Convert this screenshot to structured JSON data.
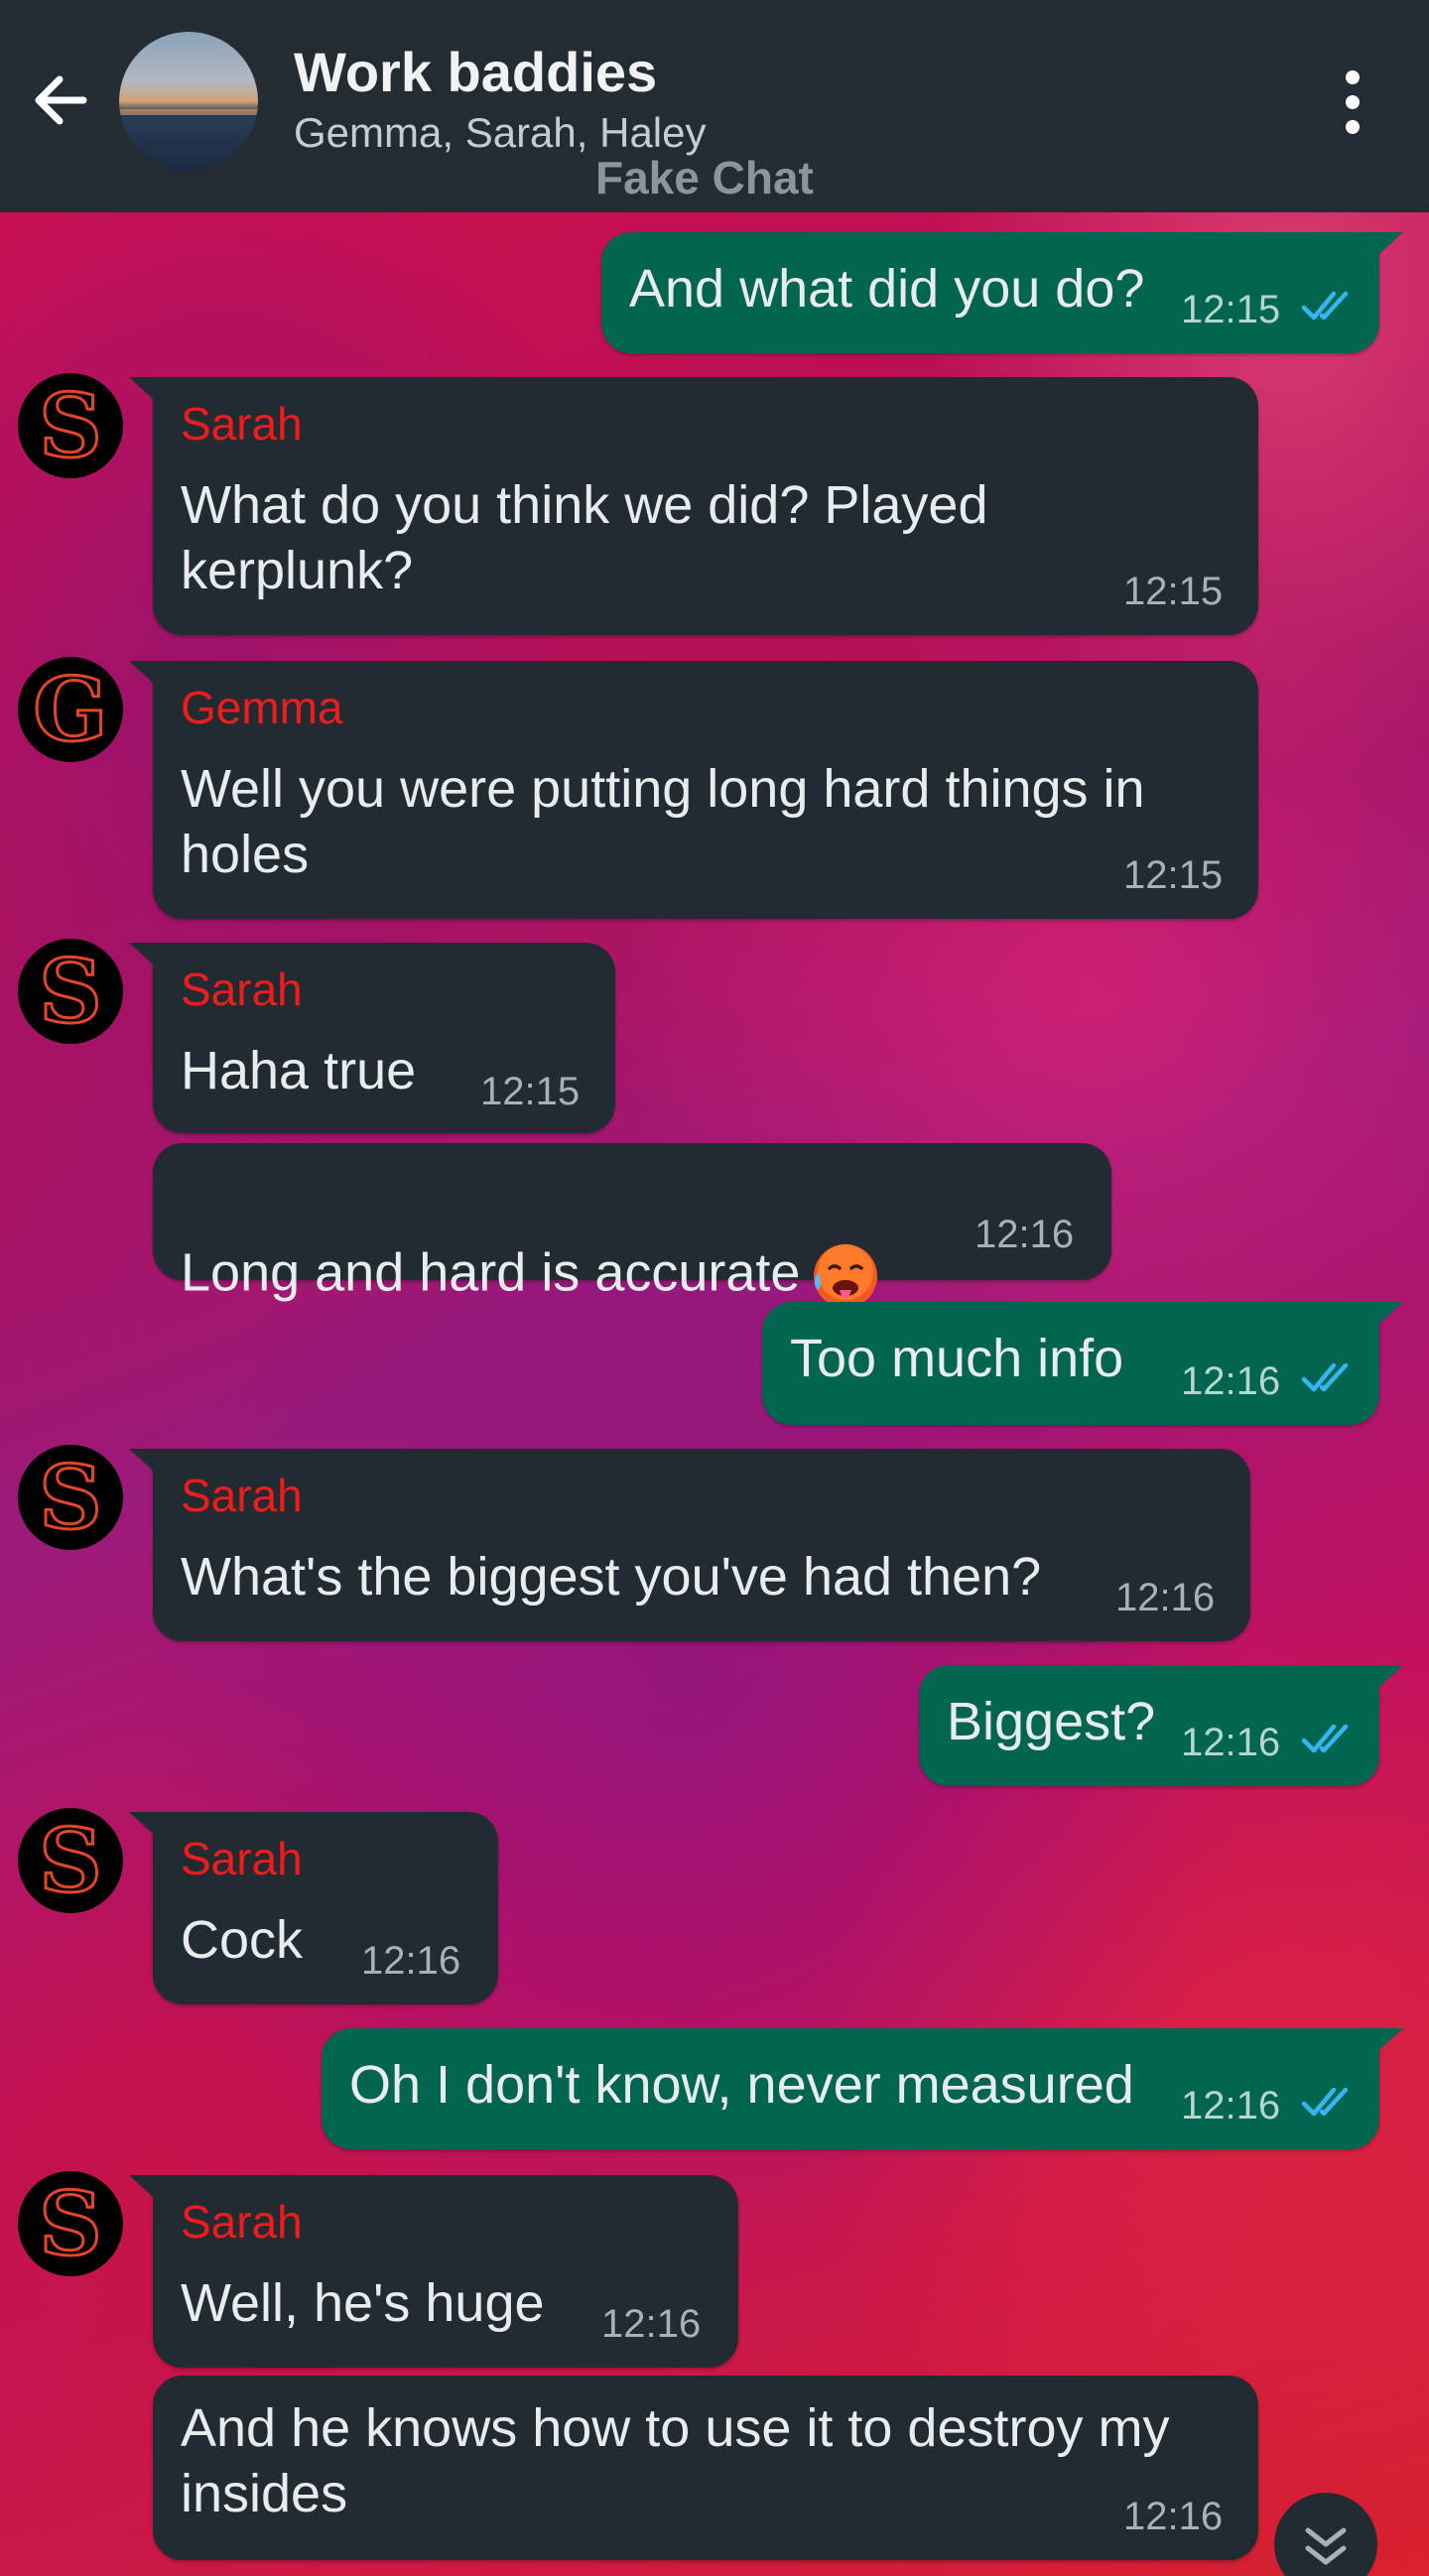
{
  "header": {
    "title": "Work baddies",
    "members": "Gemma, Sarah, Haley",
    "watermark": "Fake Chat"
  },
  "colors": {
    "header_bg": "#222c32",
    "incoming_bubble": "#222b31",
    "outgoing_bubble": "#02654f",
    "sender_name": "#ef1c1c",
    "read_ticks": "#34b7f1"
  },
  "messages": [
    {
      "direction": "out",
      "text": "And what did you do?",
      "time": "12:15",
      "status": "read"
    },
    {
      "direction": "in",
      "sender": "Sarah",
      "avatar": "S",
      "text": "What do you think we did? Played\nkerplunk?",
      "time": "12:15"
    },
    {
      "direction": "in",
      "sender": "Gemma",
      "avatar": "G",
      "text": "Well you were putting long hard things in\nholes",
      "time": "12:15"
    },
    {
      "direction": "in",
      "sender": "Sarah",
      "avatar": "S",
      "text": "Haha true",
      "time": "12:15"
    },
    {
      "direction": "in",
      "text": "Long and hard is accurate",
      "emoji": "hot-face",
      "time": "12:16"
    },
    {
      "direction": "out",
      "text": "Too much info",
      "time": "12:16",
      "status": "read"
    },
    {
      "direction": "in",
      "sender": "Sarah",
      "avatar": "S",
      "text": "What's the biggest you've had then?",
      "time": "12:16"
    },
    {
      "direction": "out",
      "text": "Biggest?",
      "time": "12:16",
      "status": "read"
    },
    {
      "direction": "in",
      "sender": "Sarah",
      "avatar": "S",
      "text": "Cock",
      "time": "12:16"
    },
    {
      "direction": "out",
      "text": "Oh I don't know, never measured",
      "time": "12:16",
      "status": "read"
    },
    {
      "direction": "in",
      "sender": "Sarah",
      "avatar": "S",
      "text": "Well, he's huge",
      "time": "12:16"
    },
    {
      "direction": "in",
      "text": "And he knows how to use it to destroy my\ninsides",
      "time": "12:16"
    }
  ],
  "icons": {
    "back": "arrow-left",
    "menu": "more-vertical",
    "scroll": "double-chevron-down"
  }
}
